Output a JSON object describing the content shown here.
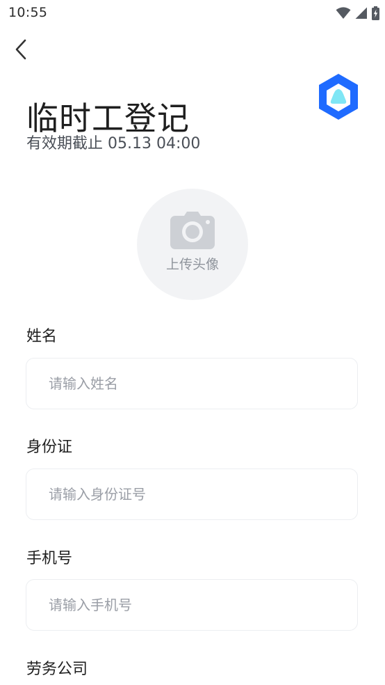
{
  "status_bar": {
    "time": "10:55"
  },
  "header": {
    "title": "临时工登记",
    "validity": "有效期截止 05.13 04:00"
  },
  "avatar": {
    "label": "上传头像"
  },
  "form": {
    "fields": [
      {
        "label": "姓名",
        "placeholder": "请输入姓名",
        "value": ""
      },
      {
        "label": "身份证",
        "placeholder": "请输入身份证号",
        "value": ""
      },
      {
        "label": "手机号",
        "placeholder": "请输入手机号",
        "value": ""
      },
      {
        "label": "劳务公司"
      }
    ]
  },
  "icons": {
    "back": "chevron-left-icon",
    "logo": "hexagon-logo-icon",
    "camera": "camera-icon",
    "wifi": "wifi-icon",
    "signal": "cell-signal-icon",
    "battery": "battery-charging-icon"
  },
  "colors": {
    "brand_blue": "#1f6bff",
    "brand_cyan": "#7fe6f5",
    "upload_bg": "#f2f3f5",
    "placeholder": "#9a9ea6",
    "input_border": "#eceef1"
  }
}
